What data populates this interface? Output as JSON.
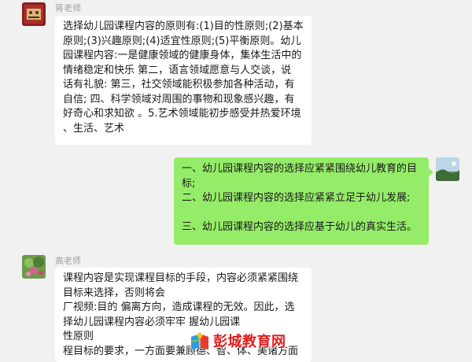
{
  "messages": [
    {
      "sender": "蒋老师",
      "lines": [
        "选择幼儿园课程内容的原则有:(1)目的性原则;(2)基本",
        "原则;(3)兴趣原则;(4)适宜性原则;(5)平衡原则。幼儿",
        "园课程内容:一是健康领域的健康身体，集体生活中的",
        "情绪稳定和快乐 第二，语言领域愿意与人交谈，说",
        "话有礼貌: 第三，社交领域能积极参加各种活动，有",
        "自信; 四、科学领域对周围的事物和现象感兴趣，有",
        "好奇心和求知欲 。5.艺术领域能初步感受并热爱环境",
        "、生活、艺术"
      ]
    },
    {
      "sender": "",
      "lines": [
        "一、幼儿园课程内容的选择应紧紧围绕幼儿教育的目",
        "标;",
        "二、幼儿园课程内容的选择应紧紧立足于幼儿发展;",
        "",
        "三、幼儿园课程内容的选择应基于幼儿的真实生活。"
      ]
    },
    {
      "sender": "高老师",
      "lines": [
        "课程内容是实现课程目标的手段，内容必须紧紧围绕",
        "目标来选择，否则将会",
        "厂视频:目的 偏离方向，造成课程的无效。因此，选",
        "择幼儿园课程内容必须牢牢 握幼儿园课",
        "性原则",
        "程目标的要求，一方面要兼顾德、智、体、美诸方面"
      ]
    }
  ],
  "watermark": {
    "text": "彭城教育网"
  }
}
